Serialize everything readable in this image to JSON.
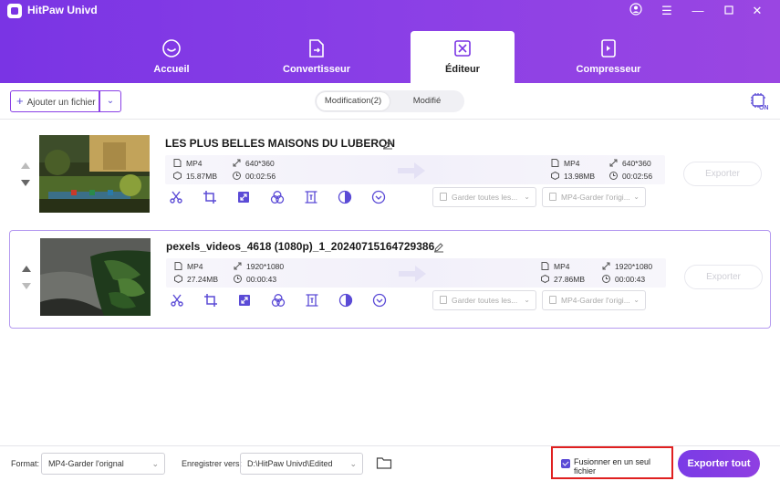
{
  "app": {
    "title": "HitPaw Univd"
  },
  "tabs": [
    {
      "label": "Accueil"
    },
    {
      "label": "Convertisseur"
    },
    {
      "label": "Éditeur"
    },
    {
      "label": "Compresseur"
    }
  ],
  "toolbar": {
    "add_file": "Ajouter un fichier",
    "segments": [
      "Modification(2)",
      "Modifié"
    ]
  },
  "files": [
    {
      "title": "LES PLUS BELLES MAISONS DU LUBERON",
      "src": {
        "format": "MP4",
        "resolution": "640*360",
        "size": "15.87MB",
        "duration": "00:02:56"
      },
      "out": {
        "format": "MP4",
        "resolution": "640*360",
        "size": "13.98MB",
        "duration": "00:02:56"
      },
      "audio_select": "Garder toutes les...",
      "format_select": "MP4-Garder l'origi...",
      "export": "Exporter",
      "thumb_caption": "LES PLUS BELLES MAISONS DU LUBERON"
    },
    {
      "title": "pexels_videos_4618 (1080p)_1_20240715164729386",
      "src": {
        "format": "MP4",
        "resolution": "1920*1080",
        "size": "27.24MB",
        "duration": "00:00:43"
      },
      "out": {
        "format": "MP4",
        "resolution": "1920*1080",
        "size": "27.86MB",
        "duration": "00:00:43"
      },
      "audio_select": "Garder toutes les...",
      "format_select": "MP4-Garder l'origi...",
      "export": "Exporter"
    }
  ],
  "footer": {
    "format_label": "Format:",
    "format_value": "MP4-Garder l'orignal",
    "save_label": "Enregistrer vers:",
    "save_value": "D:\\HitPaw Univd\\Edited",
    "merge_label": "Fusionner en un seul fichier",
    "merge_checked": true,
    "export_all": "Exporter tout"
  },
  "colors": {
    "accent": "#7a34e4",
    "highlight_box": "#e02020"
  }
}
